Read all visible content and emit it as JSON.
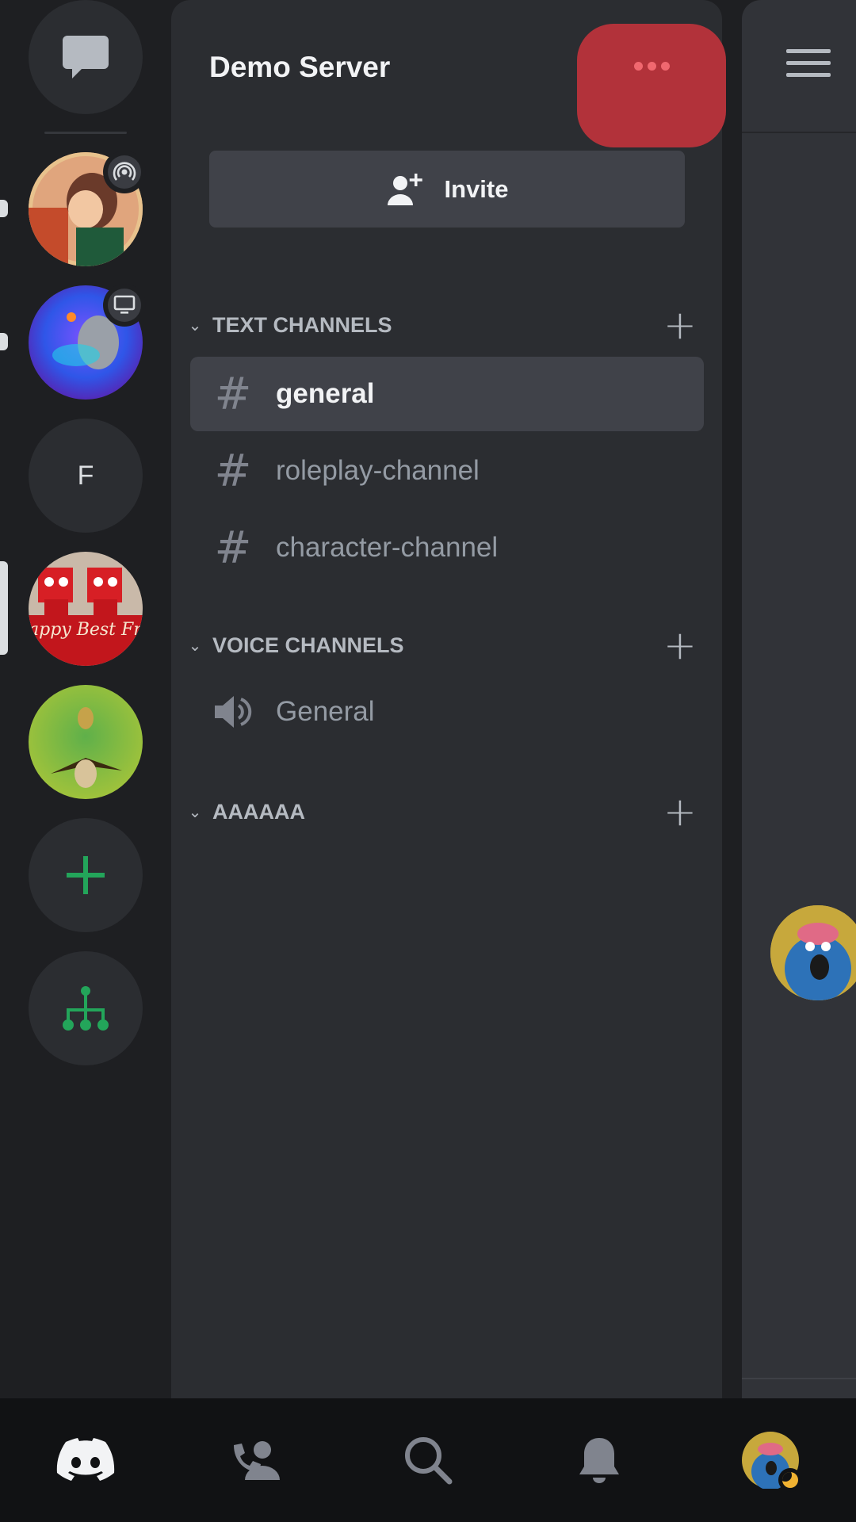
{
  "server": {
    "name": "Demo Server",
    "invite_label": "Invite"
  },
  "rail": {
    "letter_server": "F",
    "banner_text": "appy Best Friend"
  },
  "categories": [
    {
      "label": "TEXT CHANNELS",
      "channels": [
        {
          "name": "general",
          "type": "text",
          "active": true
        },
        {
          "name": "roleplay-channel",
          "type": "text"
        },
        {
          "name": "character-channel",
          "type": "text"
        }
      ]
    },
    {
      "label": "VOICE CHANNELS",
      "channels": [
        {
          "name": "General",
          "type": "voice"
        }
      ]
    },
    {
      "label": "AAAAAA",
      "channels": []
    }
  ],
  "colors": {
    "accent_green": "#23a55a",
    "more_button": "#b2323a",
    "panel": "#2b2d31"
  },
  "icons": {
    "dm": "chat-bubble-icon",
    "add_server": "plus-icon",
    "discover": "hub-icon",
    "home": "discord-logo-icon",
    "friends": "friends-icon",
    "search": "search-icon",
    "notifications": "bell-icon",
    "profile": "avatar"
  }
}
